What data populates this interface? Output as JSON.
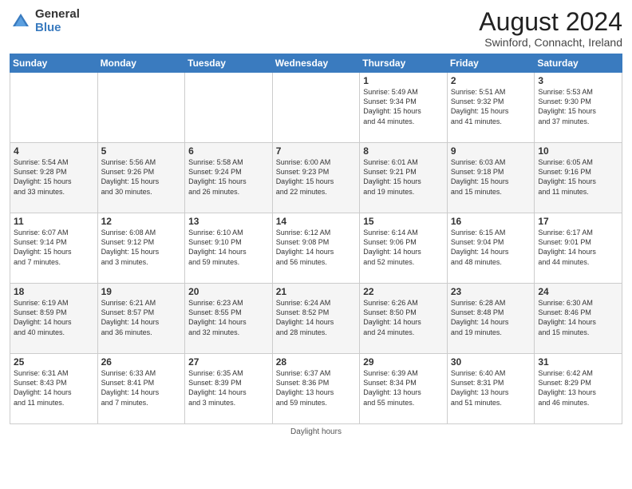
{
  "logo": {
    "general": "General",
    "blue": "Blue"
  },
  "title": "August 2024",
  "subtitle": "Swinford, Connacht, Ireland",
  "days_of_week": [
    "Sunday",
    "Monday",
    "Tuesday",
    "Wednesday",
    "Thursday",
    "Friday",
    "Saturday"
  ],
  "weeks": [
    [
      {
        "day": "",
        "info": ""
      },
      {
        "day": "",
        "info": ""
      },
      {
        "day": "",
        "info": ""
      },
      {
        "day": "",
        "info": ""
      },
      {
        "day": "1",
        "info": "Sunrise: 5:49 AM\nSunset: 9:34 PM\nDaylight: 15 hours\nand 44 minutes."
      },
      {
        "day": "2",
        "info": "Sunrise: 5:51 AM\nSunset: 9:32 PM\nDaylight: 15 hours\nand 41 minutes."
      },
      {
        "day": "3",
        "info": "Sunrise: 5:53 AM\nSunset: 9:30 PM\nDaylight: 15 hours\nand 37 minutes."
      }
    ],
    [
      {
        "day": "4",
        "info": "Sunrise: 5:54 AM\nSunset: 9:28 PM\nDaylight: 15 hours\nand 33 minutes."
      },
      {
        "day": "5",
        "info": "Sunrise: 5:56 AM\nSunset: 9:26 PM\nDaylight: 15 hours\nand 30 minutes."
      },
      {
        "day": "6",
        "info": "Sunrise: 5:58 AM\nSunset: 9:24 PM\nDaylight: 15 hours\nand 26 minutes."
      },
      {
        "day": "7",
        "info": "Sunrise: 6:00 AM\nSunset: 9:23 PM\nDaylight: 15 hours\nand 22 minutes."
      },
      {
        "day": "8",
        "info": "Sunrise: 6:01 AM\nSunset: 9:21 PM\nDaylight: 15 hours\nand 19 minutes."
      },
      {
        "day": "9",
        "info": "Sunrise: 6:03 AM\nSunset: 9:18 PM\nDaylight: 15 hours\nand 15 minutes."
      },
      {
        "day": "10",
        "info": "Sunrise: 6:05 AM\nSunset: 9:16 PM\nDaylight: 15 hours\nand 11 minutes."
      }
    ],
    [
      {
        "day": "11",
        "info": "Sunrise: 6:07 AM\nSunset: 9:14 PM\nDaylight: 15 hours\nand 7 minutes."
      },
      {
        "day": "12",
        "info": "Sunrise: 6:08 AM\nSunset: 9:12 PM\nDaylight: 15 hours\nand 3 minutes."
      },
      {
        "day": "13",
        "info": "Sunrise: 6:10 AM\nSunset: 9:10 PM\nDaylight: 14 hours\nand 59 minutes."
      },
      {
        "day": "14",
        "info": "Sunrise: 6:12 AM\nSunset: 9:08 PM\nDaylight: 14 hours\nand 56 minutes."
      },
      {
        "day": "15",
        "info": "Sunrise: 6:14 AM\nSunset: 9:06 PM\nDaylight: 14 hours\nand 52 minutes."
      },
      {
        "day": "16",
        "info": "Sunrise: 6:15 AM\nSunset: 9:04 PM\nDaylight: 14 hours\nand 48 minutes."
      },
      {
        "day": "17",
        "info": "Sunrise: 6:17 AM\nSunset: 9:01 PM\nDaylight: 14 hours\nand 44 minutes."
      }
    ],
    [
      {
        "day": "18",
        "info": "Sunrise: 6:19 AM\nSunset: 8:59 PM\nDaylight: 14 hours\nand 40 minutes."
      },
      {
        "day": "19",
        "info": "Sunrise: 6:21 AM\nSunset: 8:57 PM\nDaylight: 14 hours\nand 36 minutes."
      },
      {
        "day": "20",
        "info": "Sunrise: 6:23 AM\nSunset: 8:55 PM\nDaylight: 14 hours\nand 32 minutes."
      },
      {
        "day": "21",
        "info": "Sunrise: 6:24 AM\nSunset: 8:52 PM\nDaylight: 14 hours\nand 28 minutes."
      },
      {
        "day": "22",
        "info": "Sunrise: 6:26 AM\nSunset: 8:50 PM\nDaylight: 14 hours\nand 24 minutes."
      },
      {
        "day": "23",
        "info": "Sunrise: 6:28 AM\nSunset: 8:48 PM\nDaylight: 14 hours\nand 19 minutes."
      },
      {
        "day": "24",
        "info": "Sunrise: 6:30 AM\nSunset: 8:46 PM\nDaylight: 14 hours\nand 15 minutes."
      }
    ],
    [
      {
        "day": "25",
        "info": "Sunrise: 6:31 AM\nSunset: 8:43 PM\nDaylight: 14 hours\nand 11 minutes."
      },
      {
        "day": "26",
        "info": "Sunrise: 6:33 AM\nSunset: 8:41 PM\nDaylight: 14 hours\nand 7 minutes."
      },
      {
        "day": "27",
        "info": "Sunrise: 6:35 AM\nSunset: 8:39 PM\nDaylight: 14 hours\nand 3 minutes."
      },
      {
        "day": "28",
        "info": "Sunrise: 6:37 AM\nSunset: 8:36 PM\nDaylight: 13 hours\nand 59 minutes."
      },
      {
        "day": "29",
        "info": "Sunrise: 6:39 AM\nSunset: 8:34 PM\nDaylight: 13 hours\nand 55 minutes."
      },
      {
        "day": "30",
        "info": "Sunrise: 6:40 AM\nSunset: 8:31 PM\nDaylight: 13 hours\nand 51 minutes."
      },
      {
        "day": "31",
        "info": "Sunrise: 6:42 AM\nSunset: 8:29 PM\nDaylight: 13 hours\nand 46 minutes."
      }
    ]
  ],
  "footer": "Daylight hours"
}
